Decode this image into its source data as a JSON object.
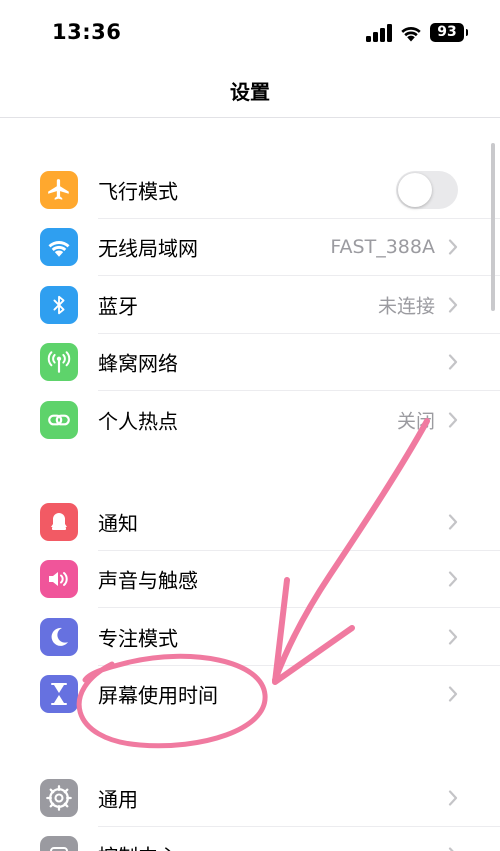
{
  "status_bar": {
    "time": "13:36",
    "battery_level": "93",
    "signal_icon": "cellular-signal-icon",
    "wifi_icon": "wifi-status-icon"
  },
  "nav": {
    "title": "设置"
  },
  "groups": [
    {
      "items": [
        {
          "label": "飞行模式",
          "icon": "airplane-icon",
          "icon_color": "#ffa82e",
          "control": "toggle",
          "toggle_on": false
        },
        {
          "label": "无线局域网",
          "icon": "wifi-icon",
          "icon_color": "#2f9ff0",
          "value": "FAST_388A"
        },
        {
          "label": "蓝牙",
          "icon": "bluetooth-icon",
          "icon_color": "#2f9ff0",
          "value": "未连接"
        },
        {
          "label": "蜂窝网络",
          "icon": "antenna-icon",
          "icon_color": "#5ed36b"
        },
        {
          "label": "个人热点",
          "icon": "hotspot-icon",
          "icon_color": "#5ed36b",
          "value": "关闭"
        }
      ]
    },
    {
      "items": [
        {
          "label": "通知",
          "icon": "bell-icon",
          "icon_color": "#f25a64"
        },
        {
          "label": "声音与触感",
          "icon": "speaker-icon",
          "icon_color": "#f0559a"
        },
        {
          "label": "专注模式",
          "icon": "moon-icon",
          "icon_color": "#6671e0"
        },
        {
          "label": "屏幕使用时间",
          "icon": "hourglass-icon",
          "icon_color": "#6671e0"
        }
      ]
    },
    {
      "items": [
        {
          "label": "通用",
          "icon": "gear-icon",
          "icon_color": "#9a9aa0"
        },
        {
          "label": "控制中心",
          "icon": "control-center-icon",
          "icon_color": "#9a9aa0"
        }
      ]
    }
  ],
  "annotation": {
    "color": "#f07aa0",
    "marks": [
      "arrow-annotation",
      "circle-annotation"
    ]
  }
}
